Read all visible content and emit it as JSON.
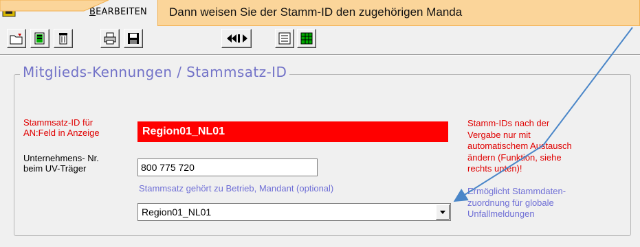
{
  "menu": {
    "item_bearbeiten_accel": "B",
    "item_bearbeiten_rest": "EARBEITEN"
  },
  "callout": {
    "text": "Dann weisen Sie der Stamm-ID den zugehörigen Manda"
  },
  "toolbar": {
    "buttons": [
      "open-folder-icon",
      "document-icon",
      "trash-icon",
      "print-icon",
      "save-icon",
      "navigate-prev-next-icon",
      "list-view-icon",
      "grid-view-icon"
    ]
  },
  "group": {
    "title": "Mitglieds-Kennungen / Stammsatz-ID"
  },
  "form": {
    "stammsatz_label_line1": "Stammsatz-ID für",
    "stammsatz_label_line2": "AN:Feld in Anzeige",
    "stammsatz_value": "Region01_NL01",
    "unternehmen_label_line1": "Unternehmens- Nr.",
    "unternehmen_label_line2": "beim UV-Träger",
    "unternehmen_value": "800 775 720",
    "betrieb_label": "Stammsatz gehört zu Betrieb, Mandant (optional)",
    "betrieb_value": "Region01_NL01"
  },
  "notes": {
    "red_lines": [
      "Stamm-IDs nach der",
      "Vergabe nur mit",
      "automatischem Austausch",
      "ändern (Funktion, siehe",
      "rechts unten)!"
    ],
    "blue_lines": [
      "Ermöglicht Stammdaten-",
      "zuordnung für globale",
      "Unfallmeldungen"
    ]
  },
  "colors": {
    "accent_blue": "#7373c8",
    "alert_red": "#e00000",
    "field_red": "#ff0000",
    "callout_bg": "#fbd59a",
    "arrow": "#4a86c8"
  }
}
